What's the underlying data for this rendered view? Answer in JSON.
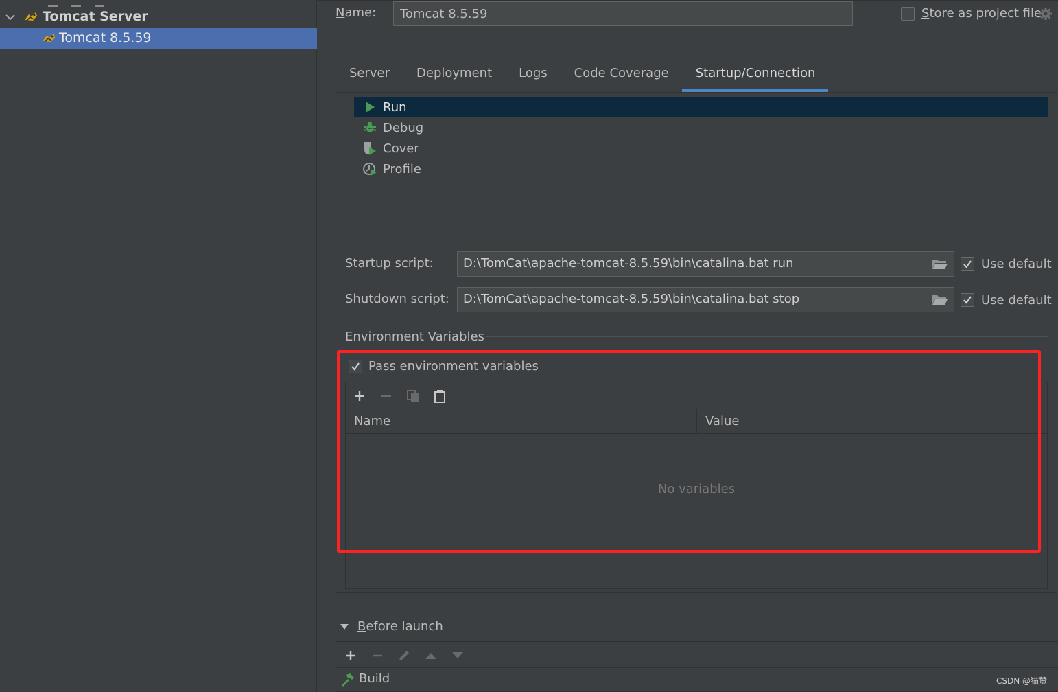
{
  "tree": {
    "group_label": "Tomcat Server",
    "child_label": "Tomcat 8.5.59"
  },
  "header": {
    "name_label_mnemonic": "N",
    "name_label_rest": "ame:",
    "name_value": "Tomcat 8.5.59",
    "store_label_mnemonic": "S",
    "store_label_rest": "tore as project file"
  },
  "tabs": [
    {
      "label": "Server"
    },
    {
      "label": "Deployment"
    },
    {
      "label": "Logs"
    },
    {
      "label": "Code Coverage"
    },
    {
      "label": "Startup/Connection"
    }
  ],
  "active_tab": "Startup/Connection",
  "modes": [
    {
      "label": "Run",
      "icon": "run-icon"
    },
    {
      "label": "Debug",
      "icon": "debug-icon"
    },
    {
      "label": "Cover",
      "icon": "cover-icon"
    },
    {
      "label": "Profile",
      "icon": "profile-icon"
    }
  ],
  "startup": {
    "label": "Startup script:",
    "value": "D:\\TomCat\\apache-tomcat-8.5.59\\bin\\catalina.bat run",
    "use_default_label": "Use default"
  },
  "shutdown": {
    "label": "Shutdown script:",
    "value": "D:\\TomCat\\apache-tomcat-8.5.59\\bin\\catalina.bat stop",
    "use_default_label": "Use default"
  },
  "env": {
    "section_title": "Environment Variables",
    "pass_label": "Pass environment variables",
    "col_name": "Name",
    "col_value": "Value",
    "empty_text": "No variables"
  },
  "before_launch": {
    "title_mnemonic": "B",
    "title_rest": "efore launch",
    "item_label": "Build"
  },
  "watermark": "CSDN @猫赞",
  "colors": {
    "accent": "#4a88c7",
    "selection": "#4b6eaf",
    "highlight_box": "#ff2222",
    "run_green": "#499c54"
  }
}
